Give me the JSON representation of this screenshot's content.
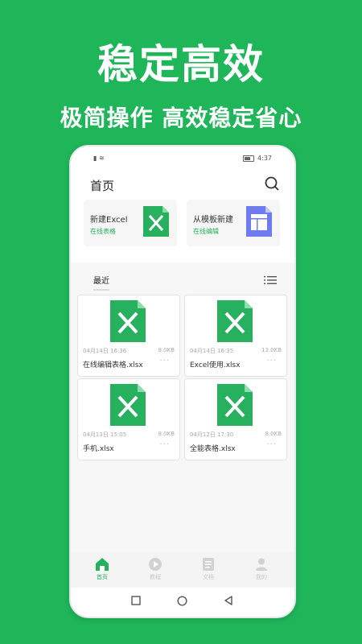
{
  "headline": "稳定高效",
  "subline": "极简操作 高效稳定省心",
  "status": {
    "time": "4:37",
    "battery": "61"
  },
  "appbar": {
    "title": "首页"
  },
  "cards": [
    {
      "title": "新建Excel",
      "sub": "在线表格",
      "icon": "excel-icon"
    },
    {
      "title": "从模板新建",
      "sub": "在线编辑",
      "icon": "template-icon"
    }
  ],
  "recent": {
    "tab": "最近"
  },
  "files": [
    {
      "date": "04月14日 16:36",
      "size": "8.0KB",
      "name": "在线编辑表格.xlsx",
      "more": "···"
    },
    {
      "date": "04月14日 16:35",
      "size": "13.0KB",
      "name": "Excel使用.xlsx",
      "more": "···"
    },
    {
      "date": "04月13日 15:05",
      "size": "8.0KB",
      "name": "手机.xlsx",
      "more": "···"
    },
    {
      "date": "04月12日 17:30",
      "size": "8.0KB",
      "name": "全能表格.xlsx",
      "more": "···"
    }
  ],
  "tabs": [
    {
      "label": "首页",
      "icon": "home-icon"
    },
    {
      "label": "教程",
      "icon": "play-icon"
    },
    {
      "label": "文档",
      "icon": "document-icon"
    },
    {
      "label": "我的",
      "icon": "user-icon"
    }
  ],
  "colors": {
    "brand": "#1fb65a",
    "accent": "#27b15f",
    "template": "#6e7cf0"
  }
}
